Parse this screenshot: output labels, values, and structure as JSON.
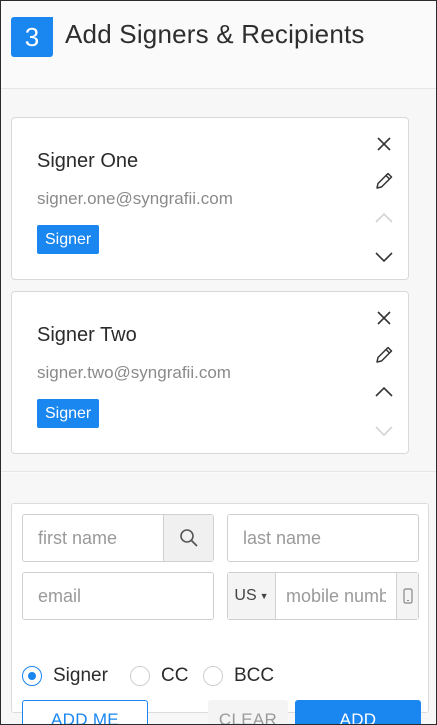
{
  "header": {
    "step_number": "3",
    "title": "Add Signers & Recipients"
  },
  "signers": [
    {
      "name": "Signer One",
      "email": "signer.one@syngrafii.com",
      "role": "Signer",
      "move_up_enabled": false,
      "move_down_enabled": true
    },
    {
      "name": "Signer Two",
      "email": "signer.two@syngrafii.com",
      "role": "Signer",
      "move_up_enabled": true,
      "move_down_enabled": false
    }
  ],
  "form": {
    "first_name_placeholder": "first name",
    "last_name_placeholder": "last name",
    "email_placeholder": "email",
    "country_code": "US",
    "mobile_placeholder": "mobile number",
    "roles": [
      {
        "label": "Signer",
        "selected": true
      },
      {
        "label": "CC",
        "selected": false
      },
      {
        "label": "BCC",
        "selected": false
      }
    ],
    "add_me_label": "ADD ME",
    "clear_label": "CLEAR",
    "add_label": "ADD"
  },
  "colors": {
    "accent": "#1a86f0",
    "disabled": "#d3d3d3",
    "icon": "#333333"
  }
}
